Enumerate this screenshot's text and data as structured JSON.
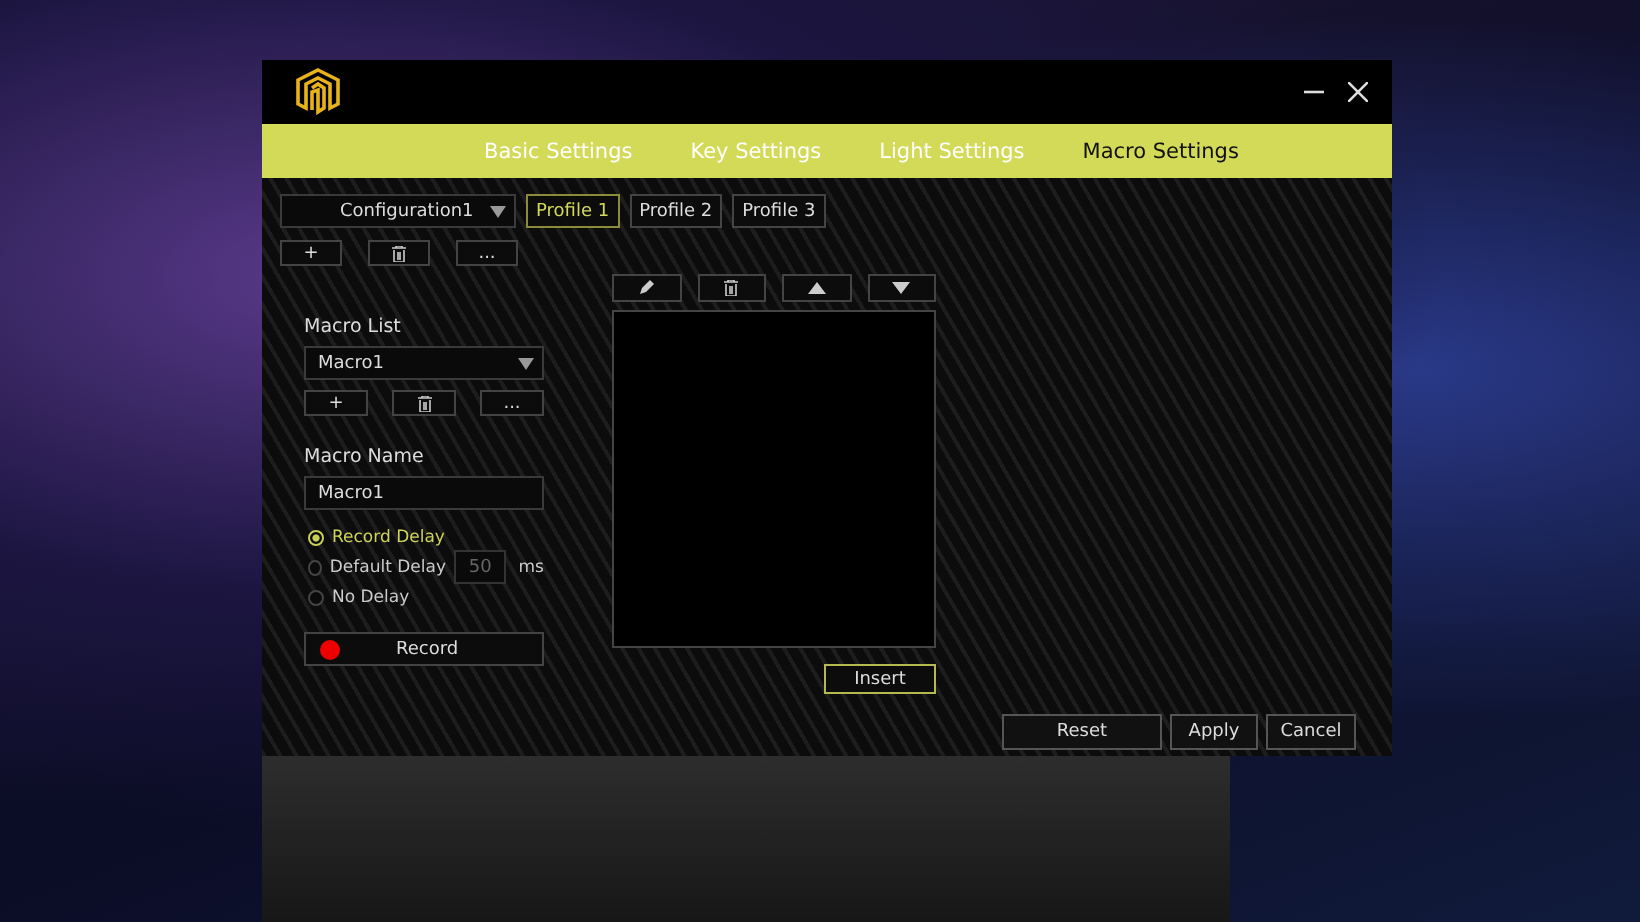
{
  "tabs": [
    {
      "label": "Basic Settings",
      "selected": false
    },
    {
      "label": "Key Settings",
      "selected": false
    },
    {
      "label": "Light Settings",
      "selected": false
    },
    {
      "label": "Macro Settings",
      "selected": true
    }
  ],
  "configuration": {
    "value": "Configuration1"
  },
  "profiles": [
    {
      "label": "Profile 1",
      "selected": true
    },
    {
      "label": "Profile 2",
      "selected": false
    },
    {
      "label": "Profile 3",
      "selected": false
    }
  ],
  "configuration_actions": [
    {
      "kind": "add",
      "label": "+"
    },
    {
      "kind": "delete"
    },
    {
      "kind": "more",
      "label": "..."
    }
  ],
  "macro_list": {
    "label": "Macro List",
    "value": "Macro1",
    "actions": [
      {
        "kind": "add",
        "label": "+"
      },
      {
        "kind": "delete"
      },
      {
        "kind": "more",
        "label": "..."
      }
    ]
  },
  "macro_name": {
    "label": "Macro Name",
    "value": "Macro1"
  },
  "delay_options": [
    {
      "label": "Record Delay",
      "selected": true
    },
    {
      "label": "Default Delay",
      "selected": false
    },
    {
      "label": "No Delay",
      "selected": false
    }
  ],
  "default_delay": {
    "value": "50",
    "unit": "ms",
    "disabled": true
  },
  "record_button": {
    "label": "Record"
  },
  "editor_toolbar": [
    {
      "kind": "edit"
    },
    {
      "kind": "delete"
    },
    {
      "kind": "up"
    },
    {
      "kind": "down"
    }
  ],
  "insert_button": {
    "label": "Insert"
  },
  "footer_buttons": [
    {
      "label": "Reset"
    },
    {
      "label": "Apply"
    },
    {
      "label": "Cancel"
    }
  ]
}
